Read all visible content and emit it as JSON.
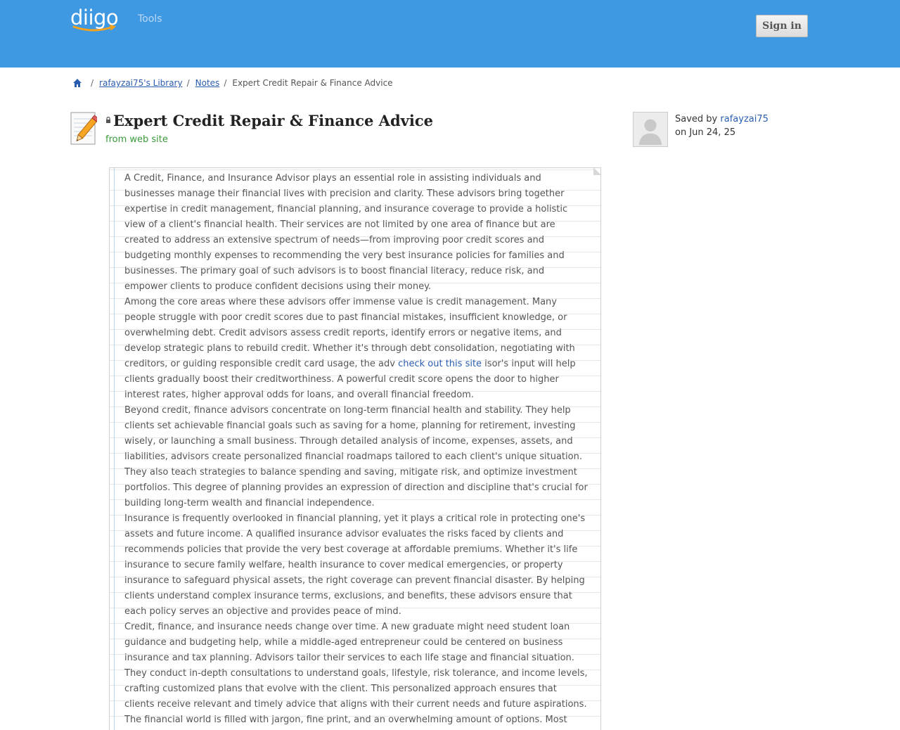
{
  "header": {
    "logo": "diigo",
    "tools_label": "Tools",
    "sign_in_label": "Sign in",
    "background_color": "#3f98e2"
  },
  "breadcrumb": {
    "home_icon": "home-icon",
    "separator": "/",
    "library": "rafayzai75's Library",
    "notes": "Notes",
    "current": "Expert Credit Repair & Finance Advice"
  },
  "note": {
    "icon": "note-pencil-icon",
    "lock_icon": "lock-icon",
    "title": "Expert Credit Repair & Finance Advice",
    "source": "from web site",
    "paragraphs": [
      "A Credit, Finance, and Insurance Advisor plays an essential role in assisting individuals and businesses manage their financial lives with precision and clarity. These advisors bring together expertise in credit management, financial planning, and insurance coverage to provide a holistic view of a client's financial health. Their services are not limited by one area of finance but are created to address an extensive spectrum of needs—from improving poor credit scores and budgeting monthly expenses to recommending the very best insurance policies for families and businesses. The primary goal of such advisors is to boost financial literacy, reduce risk, and empower clients to produce confident decisions using their money.",
      {
        "before": "Among the core areas where these advisors offer immense value is credit management. Many people struggle with poor credit scores due to past financial mistakes, insufficient knowledge, or overwhelming debt. Credit advisors assess credit reports, identify errors or negative items, and develop strategic plans to rebuild credit. Whether it's through debt consolidation, negotiating with creditors, or guiding responsible credit card usage, the adv ",
        "link": "check out this site",
        "after": " isor's input will help clients gradually boost their creditworthiness. A powerful credit score opens the door to higher interest rates, higher approval odds for loans, and overall financial freedom."
      },
      "Beyond credit, finance advisors concentrate on long-term financial health and stability. They help clients set achievable financial goals such as saving for a home, planning for retirement, investing wisely, or launching a small business. Through detailed analysis of income, expenses, assets, and liabilities, advisors create personalized financial roadmaps tailored to each client's unique situation. They also teach strategies to balance spending and saving, mitigate risk, and optimize investment portfolios. This degree of planning provides an expression of direction and discipline that's crucial for building long-term wealth and financial independence.",
      "Insurance is frequently overlooked in financial planning, yet it plays a critical role in protecting one's assets and future income. A qualified insurance advisor evaluates the risks faced by clients and recommends policies that provide the very best coverage at affordable premiums. Whether it's life insurance to secure family welfare, health insurance to cover medical emergencies, or property insurance to safeguard physical assets, the right coverage can prevent financial disaster. By helping clients understand complex insurance terms, exclusions, and benefits, these advisors ensure that each policy serves an objective and provides peace of mind.",
      "Credit, finance, and insurance needs change over time. A new graduate might need student loan guidance and budgeting help, while a middle-aged entrepreneur could be centered on business insurance and tax planning. Advisors tailor their services to each life stage and financial situation. They conduct in-depth consultations to understand goals, lifestyle, risk tolerance, and income levels, crafting customized plans that evolve with the client. This personalized approach ensures that clients receive relevant and timely advice that aligns with their current needs and future aspirations.",
      "The financial world is filled with jargon, fine print, and an overwhelming amount of options. Most individuals don't have the full time or expertise to compare loan terms, insurance premiums, or investment vehicles."
    ]
  },
  "saved": {
    "avatar_icon": "default-user-avatar",
    "prefix": "Saved by",
    "user": "rafayzai75",
    "date": "on Jun 24, 25"
  }
}
